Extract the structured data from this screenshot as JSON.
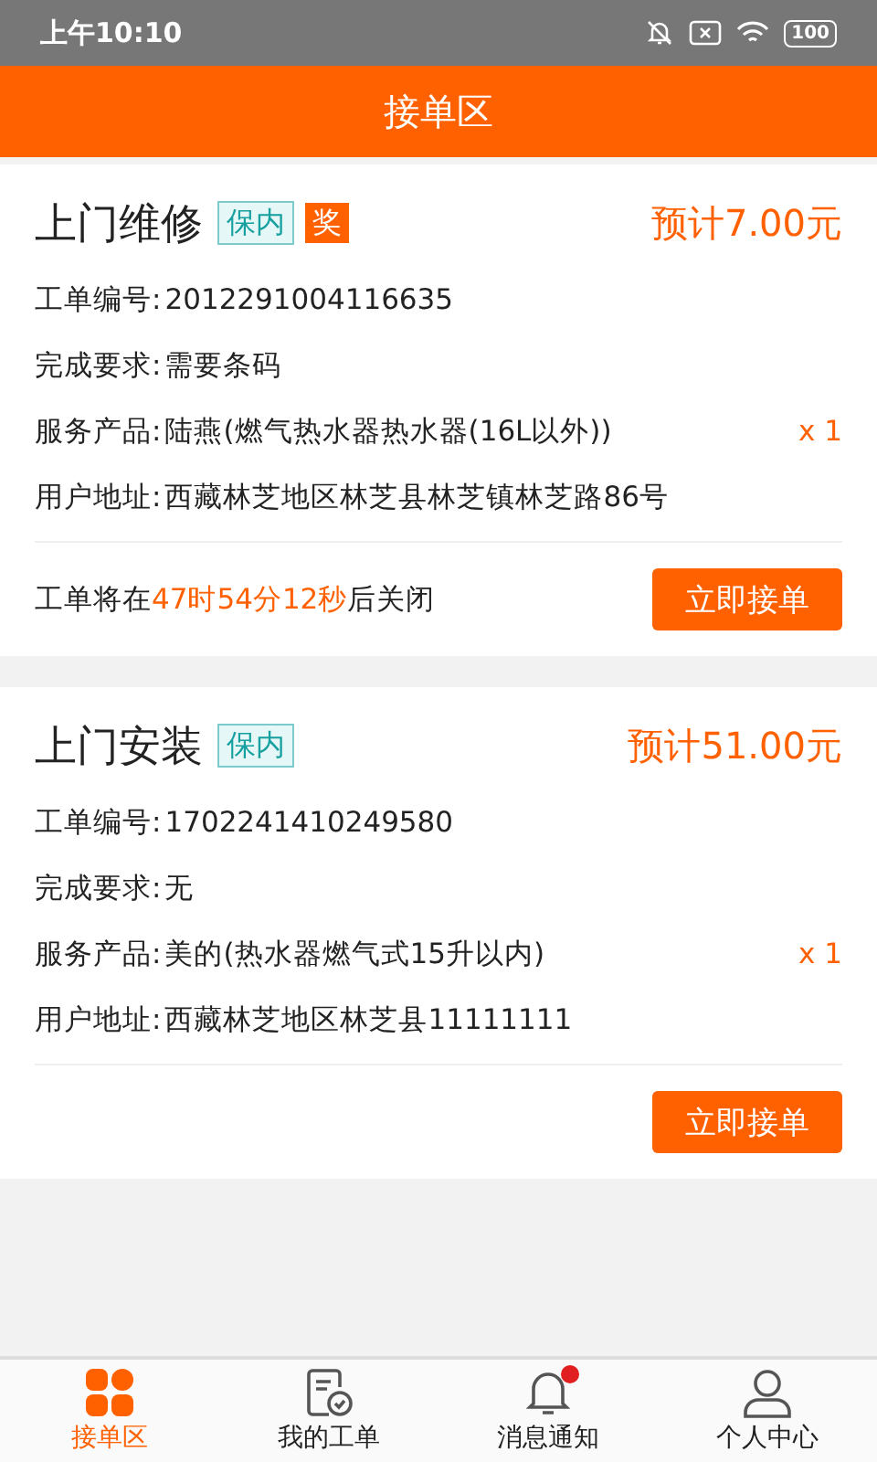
{
  "status_bar": {
    "time": "上午10:10",
    "battery": "100"
  },
  "header": {
    "title": "接单区"
  },
  "orders": [
    {
      "title": "上门维修",
      "tags": [
        {
          "label": "保内",
          "kind": "warranty"
        },
        {
          "label": "奖",
          "kind": "reward"
        }
      ],
      "price": "预计7.00元",
      "fields": [
        {
          "label": "工单编号:",
          "value": "2012291004116635"
        },
        {
          "label": "完成要求:",
          "value": "需要条码"
        },
        {
          "label": "服务产品:",
          "value": "陆燕(燃气热水器热水器(16L以外))",
          "quantity": "x 1"
        },
        {
          "label": "用户地址:",
          "value": "西藏林芝地区林芝县林芝镇林芝路86号"
        }
      ],
      "countdown": {
        "prefix": "工单将在",
        "time": "47时54分12秒",
        "suffix": "后关闭"
      },
      "button": "立即接单"
    },
    {
      "title": "上门安装",
      "tags": [
        {
          "label": "保内",
          "kind": "warranty"
        }
      ],
      "price": "预计51.00元",
      "fields": [
        {
          "label": "工单编号:",
          "value": "1702241410249580"
        },
        {
          "label": "完成要求:",
          "value": "无"
        },
        {
          "label": "服务产品:",
          "value": "美的(热水器燃气式15升以内)",
          "quantity": "x 1"
        },
        {
          "label": "用户地址:",
          "value": "西藏林芝地区林芝县11111111"
        }
      ],
      "button": "立即接单"
    }
  ],
  "tab_bar": [
    {
      "label": "接单区",
      "kind": "grid",
      "selected": true,
      "unread": false
    },
    {
      "label": "我的工单",
      "kind": "doc",
      "selected": false,
      "unread": false
    },
    {
      "label": "消息通知",
      "kind": "bell",
      "selected": false,
      "unread": true
    },
    {
      "label": "个人中心",
      "kind": "person",
      "selected": false,
      "unread": false
    }
  ]
}
